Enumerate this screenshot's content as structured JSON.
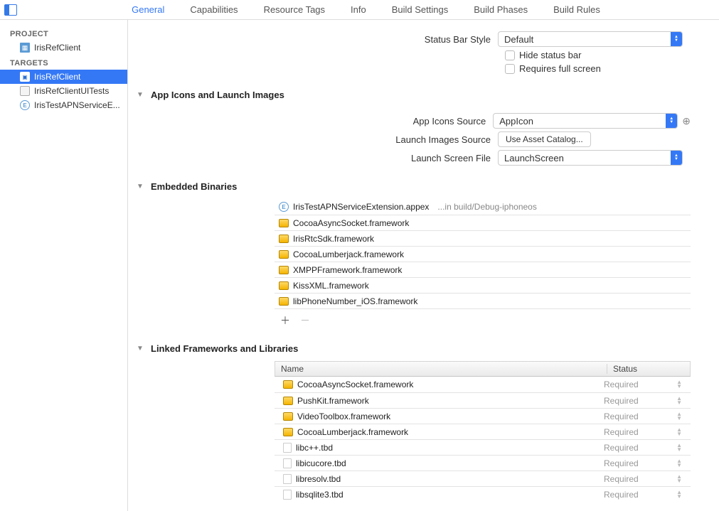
{
  "tabs": [
    "General",
    "Capabilities",
    "Resource Tags",
    "Info",
    "Build Settings",
    "Build Phases",
    "Build Rules"
  ],
  "activeTab": 0,
  "sidebar": {
    "project_hdr": "PROJECT",
    "project_item": "IrisRefClient",
    "targets_hdr": "TARGETS",
    "targets": [
      "IrisRefClient",
      "IrisRefClientUITests",
      "IrisTestAPNServiceE..."
    ]
  },
  "statusBar": {
    "label": "Status Bar Style",
    "value": "Default",
    "hideLabel": "Hide status bar",
    "fullLabel": "Requires full screen"
  },
  "iconsSection": {
    "title": "App Icons and Launch Images",
    "appIconsLabel": "App Icons Source",
    "appIconsValue": "AppIcon",
    "launchImagesLabel": "Launch Images Source",
    "launchImagesButton": "Use Asset Catalog...",
    "launchFileLabel": "Launch Screen File",
    "launchFileValue": "LaunchScreen"
  },
  "embedded": {
    "title": "Embedded Binaries",
    "items": [
      {
        "name": "IrisTestAPNServiceExtension.appex",
        "suffix": "...in build/Debug-iphoneos",
        "icon": "ext"
      },
      {
        "name": "CocoaAsyncSocket.framework",
        "icon": "brief"
      },
      {
        "name": "IrisRtcSdk.framework",
        "icon": "brief"
      },
      {
        "name": "CocoaLumberjack.framework",
        "icon": "brief"
      },
      {
        "name": "XMPPFramework.framework",
        "icon": "brief"
      },
      {
        "name": "KissXML.framework",
        "icon": "brief"
      },
      {
        "name": "libPhoneNumber_iOS.framework",
        "icon": "brief"
      }
    ]
  },
  "linked": {
    "title": "Linked Frameworks and Libraries",
    "nameHdr": "Name",
    "statusHdr": "Status",
    "items": [
      {
        "name": "CocoaAsyncSocket.framework",
        "icon": "brief",
        "status": "Required"
      },
      {
        "name": "PushKit.framework",
        "icon": "brief",
        "status": "Required"
      },
      {
        "name": "VideoToolbox.framework",
        "icon": "brief",
        "status": "Required"
      },
      {
        "name": "CocoaLumberjack.framework",
        "icon": "brief",
        "status": "Required"
      },
      {
        "name": "libc++.tbd",
        "icon": "file",
        "status": "Required"
      },
      {
        "name": "libicucore.tbd",
        "icon": "file",
        "status": "Required"
      },
      {
        "name": "libresolv.tbd",
        "icon": "file",
        "status": "Required"
      },
      {
        "name": "libsqlite3.tbd",
        "icon": "file",
        "status": "Required"
      }
    ]
  }
}
